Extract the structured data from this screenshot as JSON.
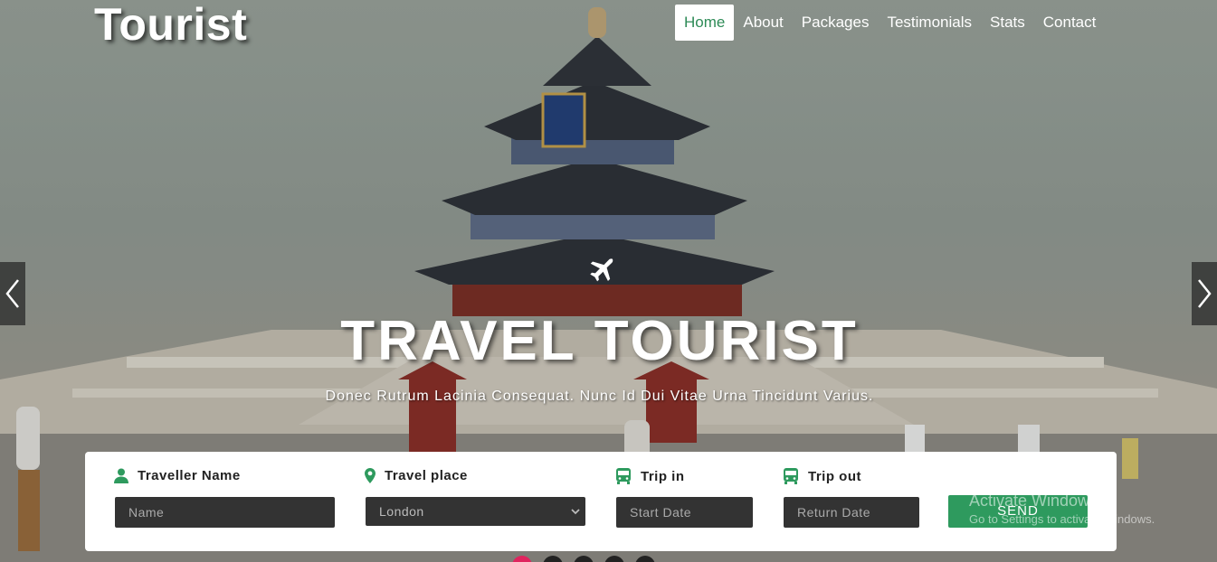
{
  "brand": {
    "logo": "Tourist"
  },
  "nav": {
    "items": [
      {
        "label": "Home",
        "active": true
      },
      {
        "label": "About"
      },
      {
        "label": "Packages"
      },
      {
        "label": "Testimonials"
      },
      {
        "label": "Stats"
      },
      {
        "label": "Contact"
      }
    ]
  },
  "hero": {
    "icon": "plane-icon",
    "title": "TRAVEL TOURIST",
    "subtitle": "Donec Rutrum Lacinia Consequat. Nunc Id Dui Vitae Urna Tincidunt Varius."
  },
  "booking": {
    "name": {
      "label": "Traveller Name",
      "icon": "user-icon",
      "placeholder": "Name"
    },
    "place": {
      "label": "Travel place",
      "icon": "map-marker-icon",
      "value": "London"
    },
    "trip_in": {
      "label": "Trip in",
      "icon": "bus-icon",
      "placeholder": "Start Date"
    },
    "trip_out": {
      "label": "Trip out",
      "icon": "bus-icon",
      "placeholder": "Return Date"
    },
    "send_label": "SEND"
  },
  "watermark": {
    "line1": "Activate Windows",
    "line2": "Go to Settings to activate Windows."
  },
  "colors": {
    "accent": "#2e9a5e",
    "nav_active": "#2e8b57",
    "input_bg": "#333333"
  }
}
